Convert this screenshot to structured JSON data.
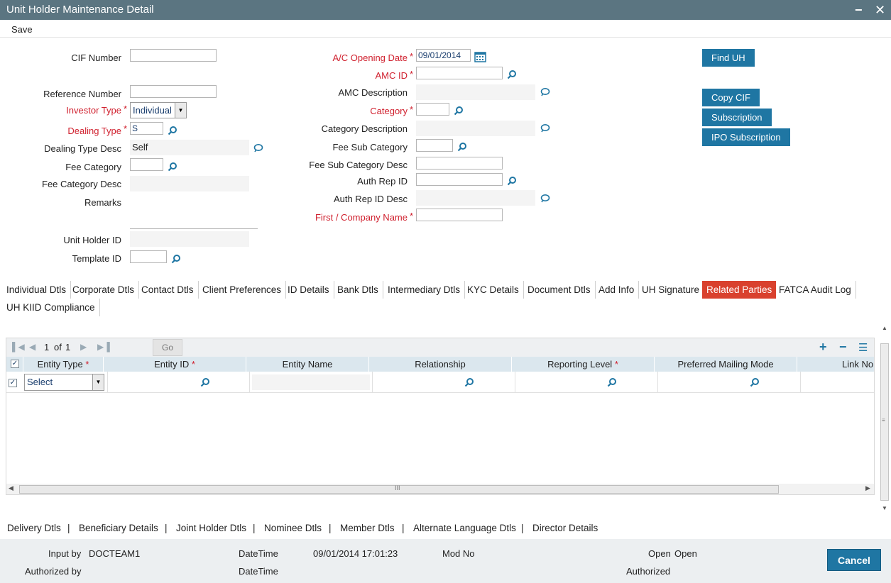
{
  "window": {
    "title": "Unit Holder Maintenance Detail",
    "minimize": "−",
    "close": "✕"
  },
  "menu": {
    "save": "Save"
  },
  "form": {
    "cif_number": "CIF Number",
    "reference_number": "Reference Number",
    "investor_type": "Investor Type",
    "investor_type_value": "Individual",
    "dealing_type": "Dealing Type",
    "dealing_type_value": "S",
    "dealing_type_desc": "Dealing Type Desc",
    "dealing_type_desc_value": "Self",
    "fee_category": "Fee Category",
    "fee_category_desc": "Fee Category Desc",
    "remarks": "Remarks",
    "unit_holder_id": "Unit Holder ID",
    "template_id": "Template ID",
    "ac_opening_date": "A/C Opening Date",
    "ac_opening_date_value": "09/01/2014",
    "amc_id": "AMC ID",
    "amc_description": "AMC Description",
    "category": "Category",
    "category_description": "Category Description",
    "fee_sub_category": "Fee Sub Category",
    "fee_sub_category_desc": "Fee Sub Category Desc",
    "auth_rep_id": "Auth Rep ID",
    "auth_rep_id_desc": "Auth Rep ID Desc",
    "first_company_name": "First / Company Name",
    "required_mark": "*"
  },
  "buttons": {
    "find_uh": "Find UH",
    "copy_cif": "Copy CIF",
    "subscription": "Subscription",
    "ipo_subscription": "IPO Subscription"
  },
  "tabs": [
    "Individual Dtls",
    "Corporate Dtls",
    "Contact Dtls",
    "Client Preferences",
    "ID Details",
    "Bank Dtls",
    "Intermediary Dtls",
    "KYC Details",
    "Document Dtls",
    "Add Info",
    "UH Signature",
    "Related Parties",
    "FATCA Audit Log",
    "UH KIID Compliance"
  ],
  "active_tab": "Related Parties",
  "grid": {
    "page_current": "1",
    "page_of": "of",
    "page_total": "1",
    "go": "Go",
    "columns": [
      "Entity Type",
      "Entity ID",
      "Entity Name",
      "Relationship",
      "Reporting Level",
      "Preferred Mailing Mode",
      "Link No"
    ],
    "row_select_value": "Select",
    "scroll_grip": "III"
  },
  "bottom_links": [
    "Delivery Dtls",
    "Beneficiary Details",
    "Joint Holder Dtls",
    "Nominee Dtls",
    "Member Dtls",
    "Alternate Language Dtls",
    "Director Details"
  ],
  "footer": {
    "input_by_label": "Input by",
    "input_by_value": "DOCTEAM1",
    "datetime_label": "DateTime",
    "datetime_value": "09/01/2014 17:01:23",
    "mod_no_label": "Mod No",
    "open_label": "Open",
    "open_value": "Open",
    "authorized_by_label": "Authorized by",
    "datetime_label2": "DateTime",
    "authorized_label": "Authorized",
    "cancel": "Cancel"
  }
}
